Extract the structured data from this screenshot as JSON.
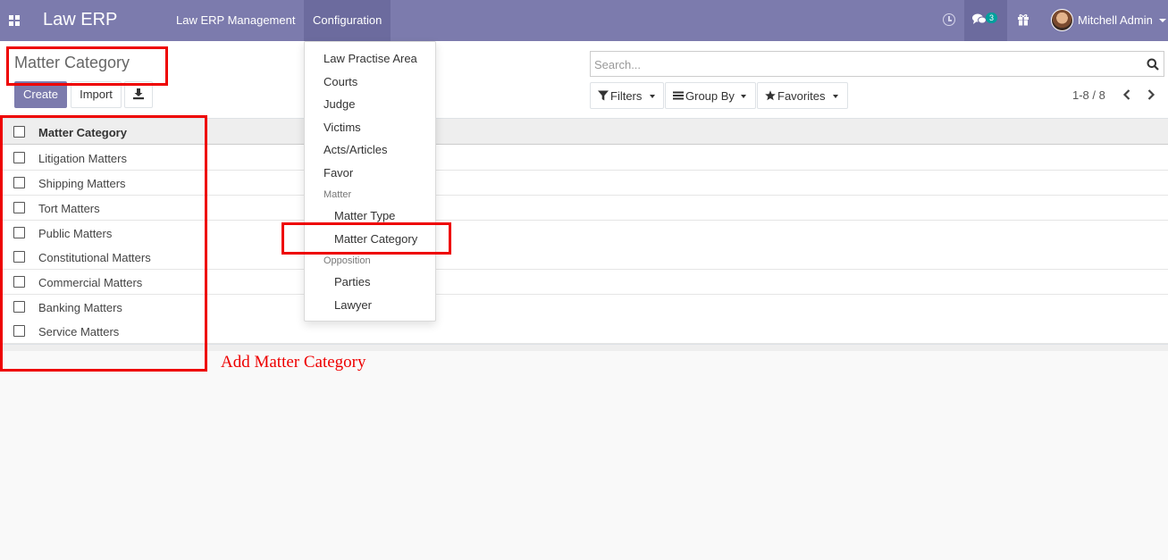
{
  "navbar": {
    "brand": "Law ERP",
    "menus": [
      {
        "label": "Law ERP Management"
      },
      {
        "label": "Configuration"
      }
    ],
    "message_count": "3",
    "user_name": "Mitchell Admin",
    "color": "#7c7bad"
  },
  "control_panel": {
    "title": "Matter Category",
    "create_label": "Create",
    "import_label": "Import",
    "search_placeholder": "Search...",
    "filters_label": "Filters",
    "group_by_label": "Group By",
    "favorites_label": "Favorites",
    "pager_value": "1-8 / 8"
  },
  "list": {
    "column_header": "Matter Category",
    "rows": [
      "Litigation Matters",
      "Shipping Matters",
      "Tort Matters",
      "Public Matters",
      "Constitutional Matters",
      "Commercial Matters",
      "Banking Matters",
      "Service Matters"
    ]
  },
  "config_menu": {
    "items": [
      "Law Practise Area",
      "Courts",
      "Judge",
      "Victims",
      "Acts/Articles",
      "Favor"
    ],
    "matter_header": "Matter",
    "matter_items": [
      "Matter Type",
      "Matter Category"
    ],
    "opposition_header": "Opposition",
    "opposition_items": [
      "Parties",
      "Lawyer"
    ]
  },
  "annotation": {
    "text": "Add Matter Category",
    "color": "#e00000"
  }
}
